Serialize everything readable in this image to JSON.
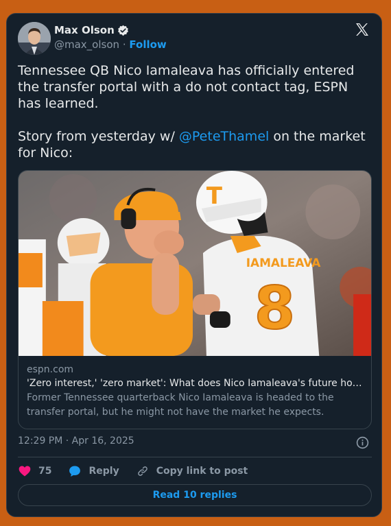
{
  "author": {
    "name": "Max Olson",
    "handle": "@max_olson",
    "separator": "·",
    "follow_label": "Follow"
  },
  "icons": {
    "verified": "verified-badge-icon",
    "platform": "x-logo-icon",
    "info": "info-icon",
    "like": "heart-icon",
    "reply": "reply-bubble-icon",
    "copy_link": "link-icon"
  },
  "tweet": {
    "line1": "Tennessee QB Nico Iamaleava has officially entered the transfer portal with a do not contact tag, ESPN has learned.",
    "line2_before": "Story from yesterday w/ ",
    "mention": "@PeteThamel",
    "line2_after": " on the market for Nico:"
  },
  "link_card": {
    "domain": "espn.com",
    "title": "'Zero interest,' 'zero market': What does Nico Iamaleava's future hold?",
    "description": "Former Tennessee quarterback Nico Iamaleava is headed to the transfer portal, but he might not have the market he expects.",
    "image_jersey_name": "IAMALEAVA",
    "image_jersey_number": "8"
  },
  "timestamp": "12:29 PM · Apr 16, 2025",
  "actions": {
    "like_count": "75",
    "reply_label": "Reply",
    "copy_label": "Copy link to post"
  },
  "read_replies_label": "Read 10 replies",
  "colors": {
    "page_background": "#c85f14",
    "card_background": "#15202b",
    "accent": "#1d9bf0",
    "like": "#f91880",
    "muted": "#8b98a5"
  }
}
